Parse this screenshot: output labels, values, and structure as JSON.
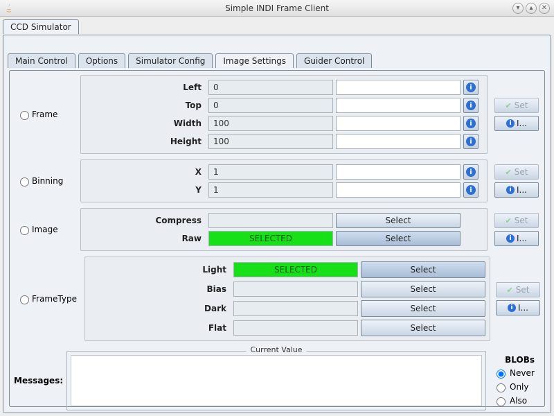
{
  "window": {
    "title": "Simple INDI Frame Client"
  },
  "outer_tabs": [
    "CCD Simulator"
  ],
  "inner_tabs": [
    "Main Control",
    "Options",
    "Simulator Config",
    "Image Settings",
    "Guider Control"
  ],
  "active_inner_tab": 3,
  "set_label": "Set",
  "info_label": "I...",
  "select_label": "Select",
  "selected_label": "SELECTED",
  "groups": {
    "frame": {
      "name": "Frame",
      "rows": [
        {
          "label": "Left",
          "value": "0"
        },
        {
          "label": "Top",
          "value": "0"
        },
        {
          "label": "Width",
          "value": "100"
        },
        {
          "label": "Height",
          "value": "100"
        }
      ]
    },
    "binning": {
      "name": "Binning",
      "rows": [
        {
          "label": "X",
          "value": "1"
        },
        {
          "label": "Y",
          "value": "1"
        }
      ]
    },
    "image": {
      "name": "Image",
      "rows": [
        {
          "label": "Compress",
          "selected": false
        },
        {
          "label": "Raw",
          "selected": true
        }
      ]
    },
    "frametype": {
      "name": "FrameType",
      "rows": [
        {
          "label": "Light",
          "selected": true
        },
        {
          "label": "Bias",
          "selected": false
        },
        {
          "label": "Dark",
          "selected": false
        },
        {
          "label": "Flat",
          "selected": false
        }
      ]
    }
  },
  "messages_label": "Messages:",
  "current_value_label": "Current Value",
  "blobs": {
    "title": "BLOBs",
    "options": [
      "Never",
      "Only",
      "Also"
    ],
    "selected": 0
  }
}
